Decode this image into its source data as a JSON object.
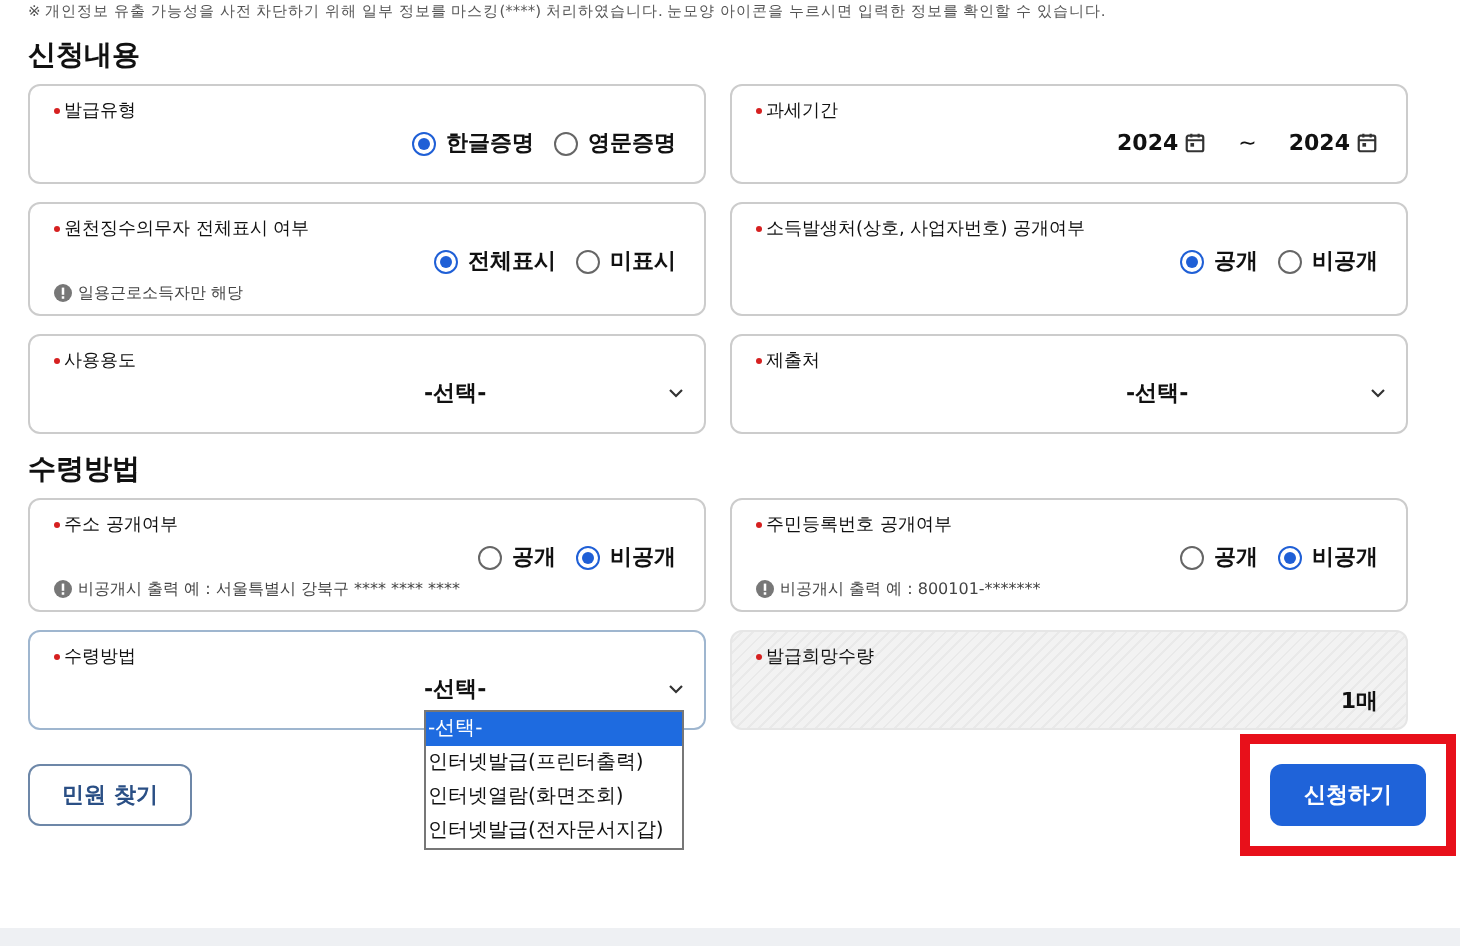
{
  "notice": "※ 개인정보 유출 가능성을 사전 차단하기 위해 일부 정보를 마스킹(****) 처리하였습니다. 눈모양 아이콘을 누르시면 입력한 정보를 확인할 수 있습니다.",
  "sections": [
    {
      "title": "신청내용",
      "fields": [
        {
          "kind": "radio",
          "label": "발급유형",
          "required": true,
          "options": [
            {
              "label": "한글증명",
              "selected": true
            },
            {
              "label": "영문증명",
              "selected": false
            }
          ]
        },
        {
          "kind": "period",
          "label": "과세기간",
          "required": true,
          "from": "2024",
          "separator": "~",
          "to": "2024"
        },
        {
          "kind": "radio",
          "label": "원천징수의무자 전체표시 여부",
          "required": true,
          "options": [
            {
              "label": "전체표시",
              "selected": true
            },
            {
              "label": "미표시",
              "selected": false
            }
          ],
          "hint": "일용근로소득자만 해당"
        },
        {
          "kind": "radio",
          "label": "소득발생처(상호, 사업자번호) 공개여부",
          "required": true,
          "options": [
            {
              "label": "공개",
              "selected": true
            },
            {
              "label": "비공개",
              "selected": false
            }
          ]
        },
        {
          "kind": "select",
          "label": "사용용도",
          "required": true,
          "value": "-선택-"
        },
        {
          "kind": "select",
          "label": "제출처",
          "required": true,
          "value": "-선택-"
        }
      ]
    },
    {
      "title": "수령방법",
      "fields": [
        {
          "kind": "radio",
          "label": "주소 공개여부",
          "required": true,
          "options": [
            {
              "label": "공개",
              "selected": false
            },
            {
              "label": "비공개",
              "selected": true
            }
          ],
          "hint": "비공개시 출력 예 : 서울특별시 강북구 **** **** ****"
        },
        {
          "kind": "radio",
          "label": "주민등록번호 공개여부",
          "required": true,
          "options": [
            {
              "label": "공개",
              "selected": false
            },
            {
              "label": "비공개",
              "selected": true
            }
          ],
          "hint": "비공개시 출력 예 : 800101-*******"
        },
        {
          "kind": "select",
          "label": "수령방법",
          "required": true,
          "value": "-선택-",
          "focused": true,
          "dropdown": [
            {
              "label": "-선택-",
              "selected": true
            },
            {
              "label": "인터넷발급(프린터출력)",
              "selected": false
            },
            {
              "label": "인터넷열람(화면조회)",
              "selected": false
            },
            {
              "label": "인터넷발급(전자문서지갑)",
              "selected": false
            }
          ]
        },
        {
          "kind": "readonly",
          "label": "발급희망수량",
          "required": true,
          "value": "1매",
          "disabled": true
        }
      ]
    }
  ],
  "buttons": [
    {
      "label": "민원 찾기",
      "kind": "secondary",
      "highlighted": false
    },
    {
      "label": "신청하기",
      "kind": "primary",
      "highlighted": true
    }
  ]
}
